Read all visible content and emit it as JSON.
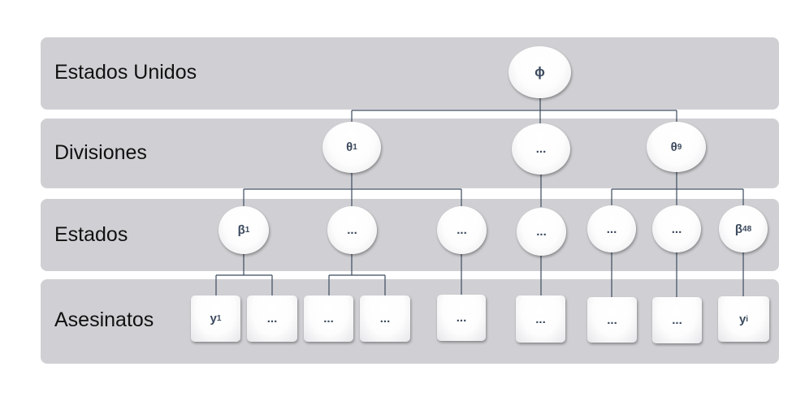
{
  "levels": {
    "us": "Estados Unidos",
    "divisions": "Divisiones",
    "states": "Estados",
    "murders": "Asesinatos"
  },
  "nodes": {
    "phi": "ϕ",
    "theta1": {
      "symbol": "θ",
      "sub": "1"
    },
    "div_ellipsis": "...",
    "theta9": {
      "symbol": "θ",
      "sub": "9"
    },
    "beta1": {
      "symbol": "β",
      "sub": "1"
    },
    "st_ellipsis": "...",
    "beta48": {
      "symbol": "β",
      "sub": "48"
    },
    "y1": {
      "symbol": "y",
      "sub": "1"
    },
    "leaf_ellipsis": "...",
    "yi": {
      "symbol": "y",
      "sub": "i"
    }
  },
  "colors": {
    "band": "#d0d0d4",
    "connector": "#3c4a5e",
    "node_text": "#3c4a5e"
  }
}
